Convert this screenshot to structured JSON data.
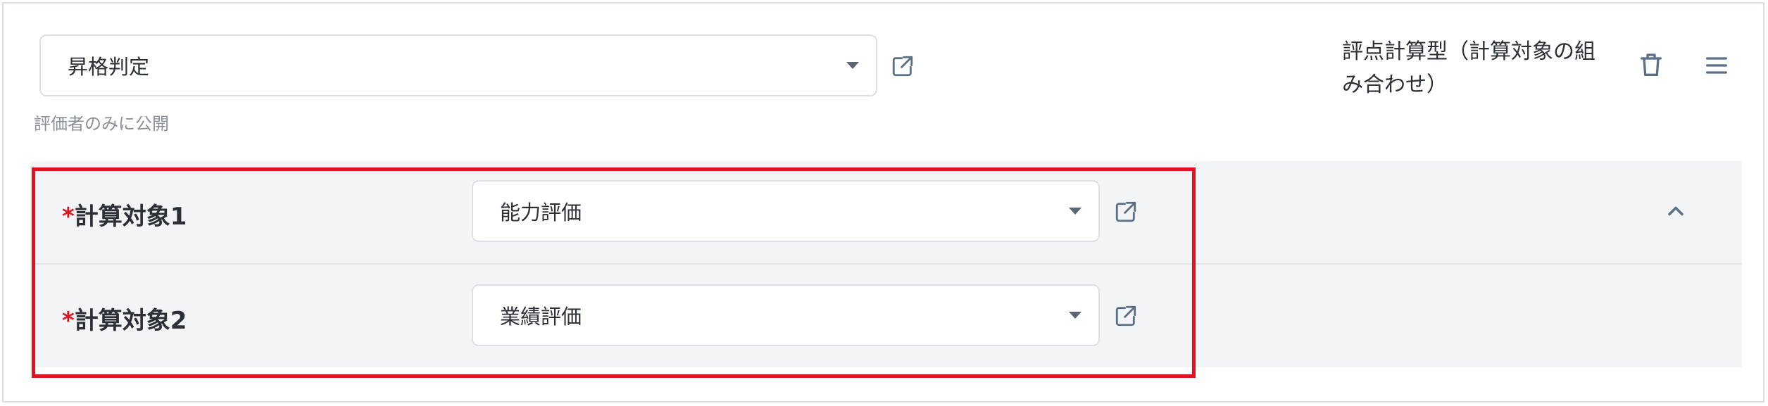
{
  "top_select": {
    "value": "昇格判定"
  },
  "visibility_note": "評価者のみに公開",
  "calc_type_label": "評点計算型（計算対象の組み合わせ）",
  "targets": [
    {
      "required_mark": "*",
      "label": "計算対象1",
      "value": "能力評価"
    },
    {
      "required_mark": "*",
      "label": "計算対象2",
      "value": "業績評価"
    }
  ],
  "icons": {
    "external_link": "external-link-icon",
    "delete": "trash-icon",
    "menu": "hamburger-menu-icon",
    "collapse": "chevron-up-icon",
    "dropdown": "caret-down-icon"
  },
  "colors": {
    "highlight_border": "#e0141e",
    "required_mark": "#e0141e",
    "panel_background": "#f3f4f6",
    "icon_color": "#5b6f86"
  }
}
